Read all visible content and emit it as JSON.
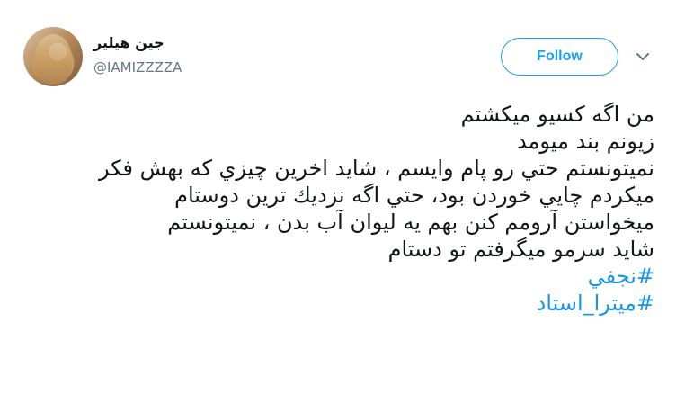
{
  "user": {
    "display_name": "جين هيلير",
    "handle": "@IAMIZZZZA"
  },
  "actions": {
    "follow_label": "Follow",
    "more_icon": "chevron-down-icon"
  },
  "tweet": {
    "lines": [
      "من اگه کسيو ميکشتم",
      "زيونم بند ميومد",
      "نميتونستم حتي رو پام وايسم ، شايد اخرين چيزي که بهش فکر",
      "ميکردم چايي خوردن بود، حتي اگه نزديك ترين دوستام",
      "ميخواستن آرومم کنن بهم يه ليوان آب بدن ، نميتونستم",
      "شايد سرمو ميگرفتم تو دستام"
    ],
    "hashtags": [
      "#نجفي",
      "#ميترا_استاد"
    ]
  },
  "colors": {
    "accent": "#1da1f2",
    "hashtag": "#1b95e0",
    "text": "#14171a",
    "muted": "#657786"
  }
}
